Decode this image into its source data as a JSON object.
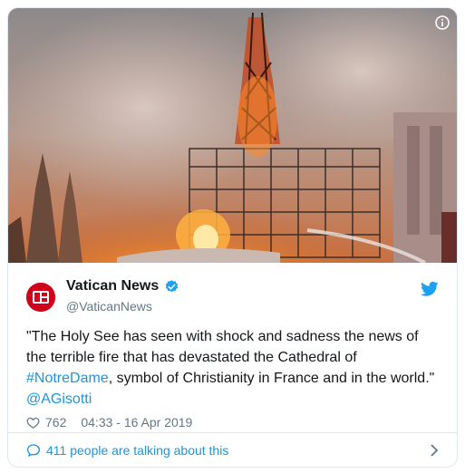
{
  "tweet": {
    "account_name": "Vatican News",
    "handle": "@VaticanNews",
    "text_line1": "\"The Holy See has seen with shock and sadness the news of",
    "text_line2": "the terrible fire that has devastated the Cathedral of",
    "hashtag": "#NotreDame",
    "text_line3_rest": ", symbol of Christianity in France and in the world.\"",
    "mention": "@AGisotti",
    "likes": "762",
    "timestamp": "04:33 - 16 Apr 2019",
    "talking": "411 people are talking about this"
  },
  "colors": {
    "link": "#1b95e0",
    "muted": "#657786",
    "avatar_red": "#d0021b"
  },
  "icons": {
    "info": "info-icon",
    "verified": "verified-badge-icon",
    "bird": "twitter-bird-icon",
    "heart": "heart-icon",
    "bubble": "speech-bubble-icon",
    "chevron": "chevron-right-icon"
  }
}
